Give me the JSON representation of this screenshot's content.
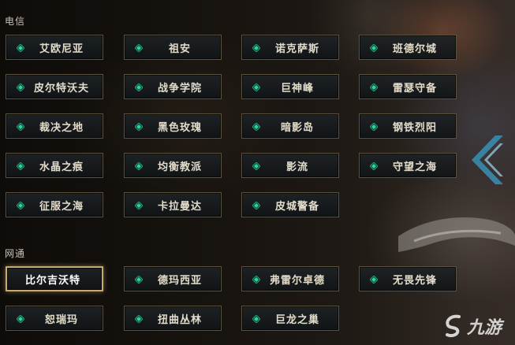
{
  "sections": [
    {
      "label": "电信",
      "servers": [
        "艾欧尼亚",
        "祖安",
        "诺克萨斯",
        "班德尔城",
        "皮尔特沃夫",
        "战争学院",
        "巨神峰",
        "雷瑟守备",
        "裁决之地",
        "黑色玫瑰",
        "暗影岛",
        "钢铁烈阳",
        "水晶之痕",
        "均衡教派",
        "影流",
        "守望之海",
        "征服之海",
        "卡拉曼达",
        "皮城警备"
      ]
    },
    {
      "label": "网通",
      "servers": [
        "比尔吉沃特",
        "德玛西亚",
        "弗雷尔卓德",
        "无畏先锋",
        "恕瑞玛",
        "扭曲丛林",
        "巨龙之巢"
      ]
    }
  ],
  "selected_server": "比尔吉沃特",
  "watermark": {
    "text": "九游"
  },
  "icons": {
    "server_dot": "green-diamond-icon",
    "side_arrow": "chevron-left-icon"
  },
  "colors": {
    "accent_green": "#1fa37a",
    "selected_border": "#c8aa6e",
    "button_border": "#5b513f"
  }
}
